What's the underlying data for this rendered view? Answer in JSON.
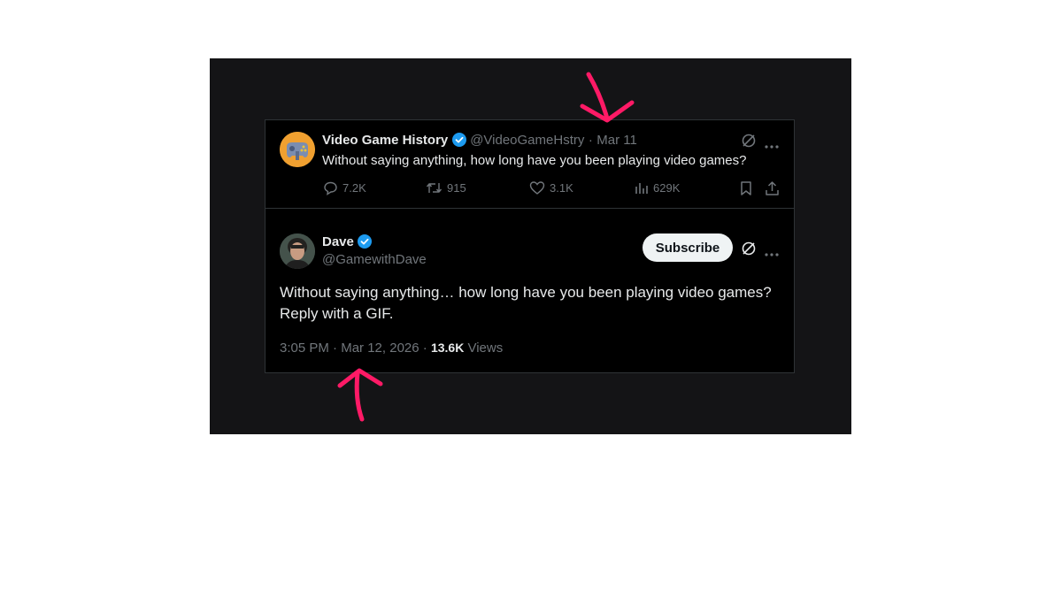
{
  "quoted_tweet": {
    "display_name": "Video Game History",
    "handle": "@VideoGameHstry",
    "separator": "·",
    "date": "Mar 11",
    "text": "Without saying anything, how long have you been playing video games?",
    "replies": "7.2K",
    "reposts": "915",
    "likes": "3.1K",
    "views": "629K"
  },
  "main_tweet": {
    "display_name": "Dave",
    "handle": "@GamewithDave",
    "subscribe_label": "Subscribe",
    "text_line1": "Without saying anything… how long have you been playing video games?",
    "text_line2": "Reply with a GIF.",
    "time": "3:05 PM",
    "sep1": "·",
    "date": "Mar 12, 2026",
    "sep2": "·",
    "views_count": "13.6K",
    "views_label": "Views"
  },
  "colors": {
    "verified": "#1d9bf0",
    "annotation": "#ff1a66"
  },
  "icons": [
    "verified-badge-icon",
    "grok-icon",
    "more-icon",
    "reply-icon",
    "repost-icon",
    "like-icon",
    "views-icon",
    "bookmark-icon",
    "share-icon",
    "annotation-arrow-icon"
  ]
}
